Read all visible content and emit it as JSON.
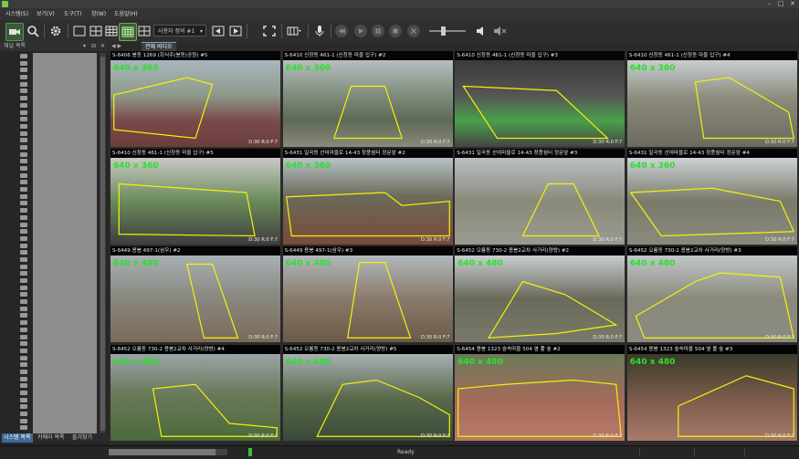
{
  "menu": [
    "시스템(S)",
    "보기(V)",
    "도구(T)",
    "창(W)",
    "도움말(H)"
  ],
  "toolbar": {
    "dropdown_value": "사용자 정의 #1",
    "icons": [
      "camera-icon",
      "search-icon",
      "gear-icon",
      "layout-1-icon",
      "layout-4-icon",
      "layout-9-icon",
      "layout-16-icon",
      "layout-25-icon",
      "prev-icon",
      "next-icon",
      "fullscreen-icon",
      "multiscreen-icon",
      "microphone-icon",
      "rewind-icon",
      "play-icon",
      "pause-icon",
      "stop-icon",
      "close-icon",
      "volume-slider",
      "speaker-icon",
      "mute-icon"
    ]
  },
  "sidepanel": {
    "title": "채널 목록",
    "tabs": [
      "시스템 목록",
      "카메라 목록",
      "즐겨찾기"
    ]
  },
  "tabs": {
    "nav": "◀ ▶",
    "active": "전체 비디오"
  },
  "tiles": [
    {
      "caption": "S-6406 봉동 1269 (회식주(봉동)공원) #5",
      "res": "640 x 360",
      "osd": "D:30 R:0 F:7"
    },
    {
      "caption": "S-6410 신창동 461-1 (신창동 마을 입구) #2",
      "res": "640 x 360",
      "osd": "D:30 R:0 F:7"
    },
    {
      "caption": "S-6410 신창동 461-1 (신창동 마을 입구) #3",
      "res": "",
      "osd": "D:30 R:0 F:7"
    },
    {
      "caption": "S-6410 신창동 461-1 (신창동 마을 입구) #4",
      "res": "640 x 360",
      "osd": "D:30 R:0 F:7"
    },
    {
      "caption": "S-6410 신창동 461-1 (신창동 마을 입구) #5",
      "res": "640 x 360",
      "osd": "D:30 R:0 F:7"
    },
    {
      "caption": "S-6431 일곡동 산여마을로 14-43  청풍쉼터 정문앞 #2",
      "res": "640 x 360",
      "osd": "D:30 R:0 F:7"
    },
    {
      "caption": "S-6431 일곡동 산여마을로 14-43  청풍쉼터 정문앞 #3",
      "res": "",
      "osd": "D:30 R:0 F:7"
    },
    {
      "caption": "S-6431 일곡동 산여마을로 14-43  청풍쉼터 정문앞 #4",
      "res": "640 x 360",
      "osd": "D:30 R:0 F:7"
    },
    {
      "caption": "S-6449 용봉 497-1(삼우) #2",
      "res": "640 x 480",
      "osd": "D:30 R:0 F:7"
    },
    {
      "caption": "S-6449 용봉 497-1(삼우) #3",
      "res": "640 x 480",
      "osd": "D:30 R:0 F:7"
    },
    {
      "caption": "S-6452 오룡동 730-2 용봉2교차 사거리(양방) #2",
      "res": "640 x 480",
      "osd": "D:30 R:0 F:7"
    },
    {
      "caption": "S-6452 오룡동 730-2 용봉2교차 사거리(양방) #3",
      "res": "640 x 480",
      "osd": "D:30 R:0 F:7"
    },
    {
      "caption": "S-6452 오룡동 730-2 용봉2교차 사거리(양방) #4",
      "res": "640 x 480",
      "osd": "D:30 R:0 F:7"
    },
    {
      "caption": "S-6452 오룡동 730-2 용봉2교차 사거리(양방) #5",
      "res": "640 x 480",
      "osd": "D:30 R:0 F:7"
    },
    {
      "caption": "S-6454 용봉 1323 숲속마을 504 옆 풀 숲 #2",
      "res": "640 x 480",
      "osd": "D:30 R:0 F:7"
    },
    {
      "caption": "S-6454 용봉 1323 숲속마을 504 옆 풀 숲 #3",
      "res": "640 x 480",
      "osd": "D:30 R:0 F:7"
    }
  ],
  "status": {
    "ready": "Ready",
    "progress_fraction": 0.9
  }
}
